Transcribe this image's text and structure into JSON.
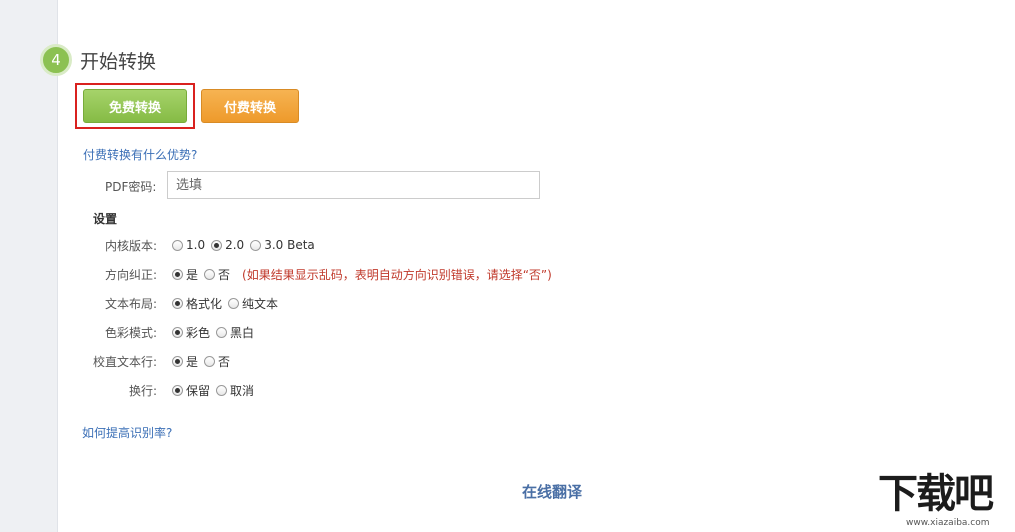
{
  "step": {
    "number": "4",
    "title": "开始转换"
  },
  "buttons": {
    "free": "免费转换",
    "paid": "付费转换"
  },
  "links": {
    "advantages": "付费转换有什么优势?",
    "improve_rate": "如何提高识别率?"
  },
  "password": {
    "label": "PDF密码:",
    "placeholder": "选填"
  },
  "settings": {
    "heading": "设置",
    "rows": [
      {
        "label": "内核版本:",
        "options": [
          "1.0",
          "2.0",
          "3.0 Beta"
        ],
        "selected": "2.0"
      },
      {
        "label": "方向纠正:",
        "options": [
          "是",
          "否"
        ],
        "selected": "是",
        "note": "(如果结果显示乱码，表明自动方向识别错误，请选择“否”)"
      },
      {
        "label": "文本布局:",
        "options": [
          "格式化",
          "纯文本"
        ],
        "selected": "格式化"
      },
      {
        "label": "色彩模式:",
        "options": [
          "彩色",
          "黑白"
        ],
        "selected": "彩色"
      },
      {
        "label": "校直文本行:",
        "options": [
          "是",
          "否"
        ],
        "selected": "是"
      },
      {
        "label": "换行:",
        "options": [
          "保留",
          "取消"
        ],
        "selected": "保留"
      }
    ]
  },
  "footer": {
    "translate": "在线翻译"
  },
  "watermark": {
    "logo": "下载吧",
    "url": "www.xiazaiba.com"
  },
  "colors": {
    "free_button": "#8cc152",
    "paid_button": "#f0a03a",
    "highlight": "#d9211f",
    "link": "#3b6fb6",
    "note": "#c0392b"
  }
}
